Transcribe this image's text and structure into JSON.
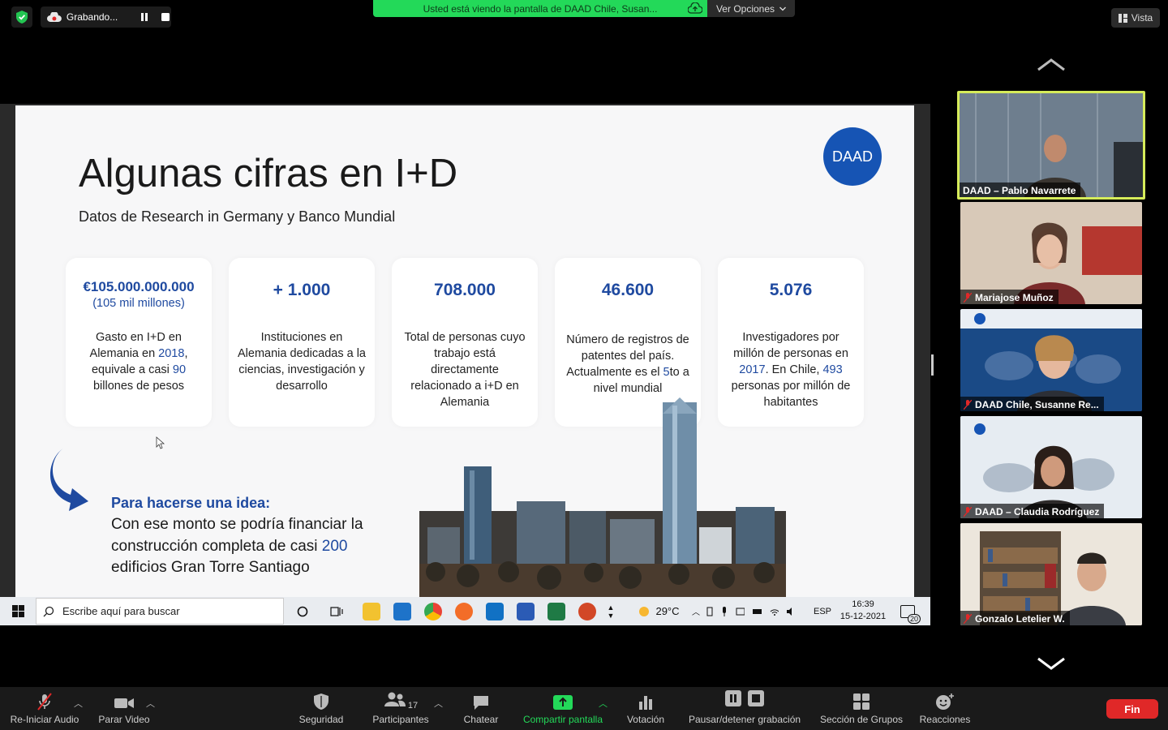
{
  "top_bar": {
    "recording_label": "Grabando...",
    "share_banner": "Usted está viendo la pantalla de DAAD Chile, Susan...",
    "view_options": "Ver Opciones",
    "view_button": "Vista"
  },
  "slide": {
    "title": "Algunas cifras en I+D",
    "subtitle": "Datos de Research in Germany y Banco Mundial",
    "logo_text": "DAAD",
    "cards": [
      {
        "big": "€105.000.000.000",
        "sub": "(105 mil millones)",
        "desc_parts": [
          "Gasto en I+D en Alemania en ",
          "2018",
          ", equivale a casi ",
          "90",
          " billones de pesos"
        ]
      },
      {
        "big": "+ 1.000",
        "desc": "Instituciones en Alemania dedicadas a la ciencias, investigación y desarrollo"
      },
      {
        "big": "708.000",
        "desc": "Total de personas cuyo trabajo está directamente relacionado a i+D en Alemania"
      },
      {
        "big": "46.600",
        "desc_parts": [
          "Número de registros de patentes del país. Actualmente es el ",
          "5",
          "to a nivel mundial"
        ]
      },
      {
        "big": "5.076",
        "desc_parts": [
          "Investigadores por millón de personas en ",
          "2017",
          ". En Chile, ",
          "493",
          " personas por millón de habitantes"
        ]
      }
    ],
    "idea_heading": "Para hacerse una idea:",
    "idea_text_parts": [
      "Con ese monto se podría financiar la construcción completa de casi ",
      "200",
      " edificios Gran Torre Santiago"
    ]
  },
  "taskbar": {
    "search_placeholder": "Escribe aquí para buscar",
    "weather": "29°C",
    "language": "ESP",
    "time": "16:39",
    "date": "15-12-2021",
    "notifications": "20"
  },
  "participants": [
    {
      "name": "DAAD – Pablo Navarrete",
      "muted": false,
      "active": true
    },
    {
      "name": "Mariajose Muñoz",
      "muted": true
    },
    {
      "name": "DAAD Chile, Susanne Re...",
      "muted": true
    },
    {
      "name": "DAAD – Claudia Rodríguez",
      "muted": true
    },
    {
      "name": "Gonzalo Letelier W.",
      "muted": true
    }
  ],
  "toolbar": {
    "unmute": "Re-Iniciar Audio",
    "stop_video": "Parar Video",
    "security": "Seguridad",
    "participants": "Participantes",
    "participants_count": "17",
    "chat": "Chatear",
    "share": "Compartir pantalla",
    "polls": "Votación",
    "recording": "Pausar/detener grabación",
    "breakout": "Sección de Grupos",
    "reactions": "Reacciones",
    "end": "Fin"
  },
  "colors": {
    "accent_blue": "#1f4aa0",
    "share_green": "#23d959",
    "end_red": "#e02828",
    "active_speaker": "#d6ec5a"
  }
}
